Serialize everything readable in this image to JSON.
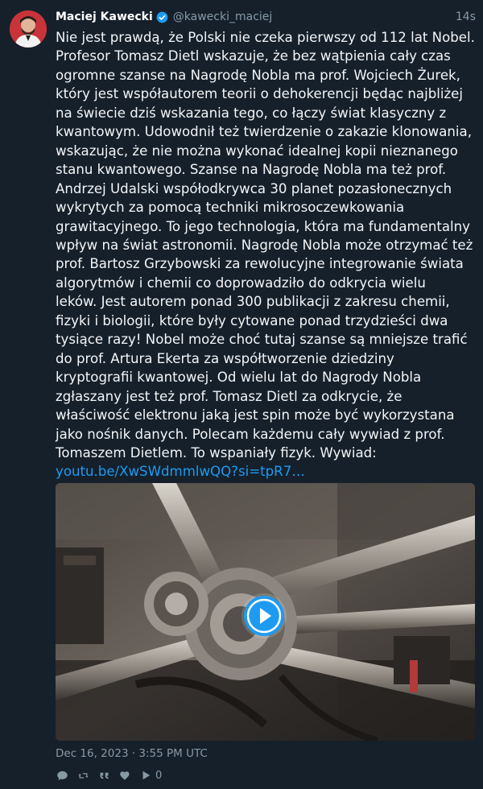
{
  "author": {
    "display_name": "Maciej Kawecki",
    "handle": "@kawecki_maciej",
    "verified": true
  },
  "timestamp_relative": "14s",
  "body": {
    "text": "Nie jest prawdą, że Polski nie czeka pierwszy od 112 lat Nobel.\nProfesor Tomasz Dietl wskazuje, że bez wątpienia cały czas\nogromne szanse na Nagrodę Nobla ma prof. Wojciech Żurek,\nktóry jest współautorem teorii o dehokerencji będąc najbliżej\nna świecie dziś wskazania tego, co łączy świat klasyczny z\nkwantowym. Udowodnił też twierdzenie o zakazie klonowania,\nwskazując, że nie można wykonać idealnej kopii nieznanego\nstanu kwantowego. Szanse na Nagrodę Nobla ma też prof.\nAndrzej Udalski współodkrywca 30 planet pozasłonecznych\nwykrytych za pomocą techniki mikrosoczewkowania\ngrawitacyjnego. To jego technologia, która ma fundamentalny\nwpływ na świat astronomii. Nagrodę Nobla może otrzymać też\nprof. Bartosz Grzybowski za rewolucyjne integrowanie świata\nalgorytmów i chemii co doprowadziło do odkrycia wielu\nleków. Jest autorem ponad 300 publikacji z zakresu chemii,\nfizyki i biologii, które były cytowane ponad trzydzieści dwa\ntysiące razy! Nobel może choć tutaj szanse są mniejsze trafić\ndo prof. Artura Ekerta za współtworzenie dziedziny\nkryptografii kwantowej. Od wielu lat do Nagrody Nobla\nzgłaszany jest też prof. Tomasz Dietl za odkrycie, że\nwłaściwość elektronu jaką jest spin może być wykorzystana\njako nośnik danych. Polecam każdemu cały wywiad z prof.\nTomaszem Dietlem. To wspaniały fizyk. Wywiad:\n",
    "link": "youtu.be/XwSWdmmlwQQ?si=tpR7…"
  },
  "date": "Dec 16, 2023 · 3:55 PM UTC",
  "actions": {
    "reply_icon": "reply-icon",
    "retweet_icon": "retweet-icon",
    "quote_icon": "quote-icon",
    "like_icon": "heart-icon",
    "play_icon": "play-icon",
    "play_count": "0"
  },
  "colors": {
    "background": "#15202b",
    "text": "#f3f5f7",
    "muted": "#8899a6",
    "link": "#1d9bf0",
    "avatar_bg": "#c8343a"
  }
}
